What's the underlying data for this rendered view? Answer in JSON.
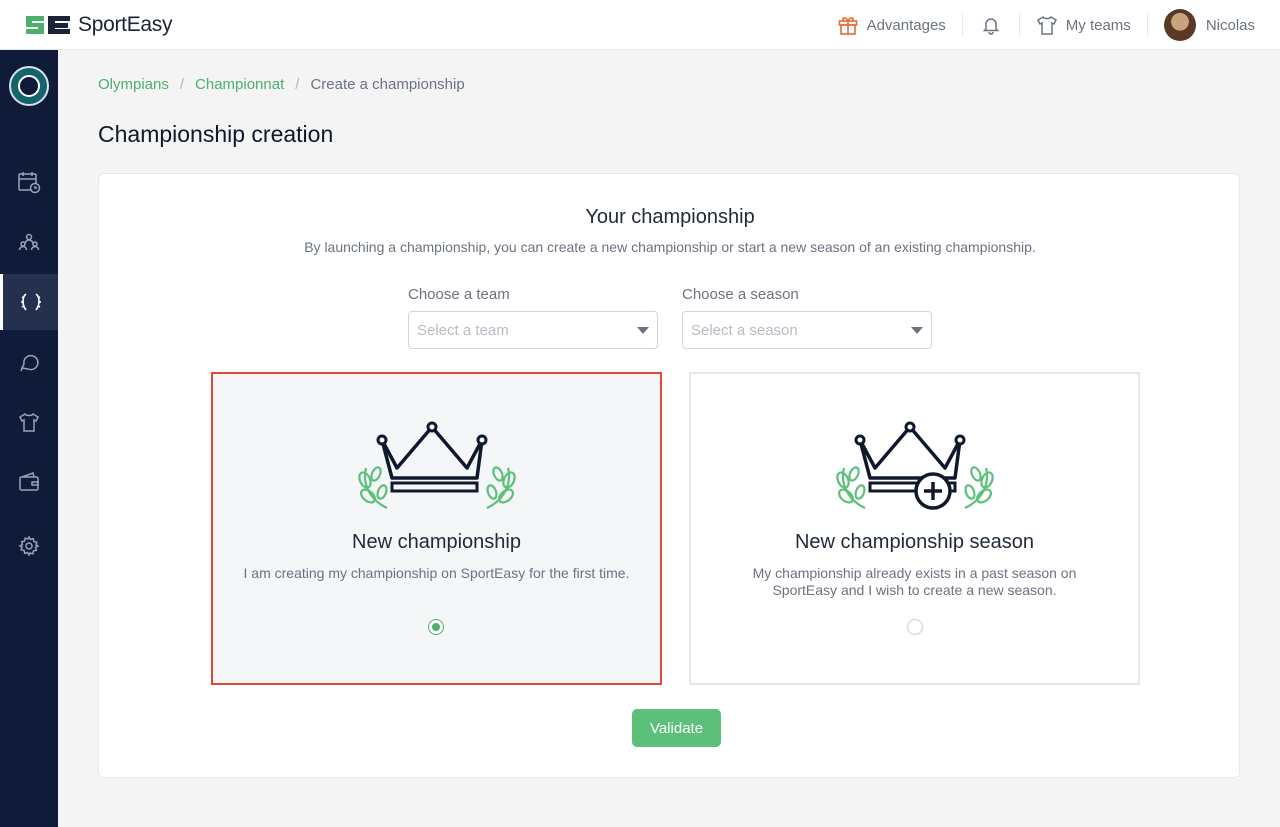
{
  "brand": {
    "name": "SportEasy",
    "accent": "#4caf6c",
    "alert": "#e0493a",
    "sidebar_bg": "#0f1b38"
  },
  "topbar": {
    "advantages_label": "Advantages",
    "my_teams_label": "My teams",
    "user_name": "Nicolas",
    "icons": [
      "gift-icon",
      "bell-icon",
      "shirt-icon",
      "avatar"
    ]
  },
  "sidebar": {
    "items": [
      {
        "name": "calendar-icon"
      },
      {
        "name": "team-members-icon"
      },
      {
        "name": "laurel-icon",
        "active": true
      },
      {
        "name": "chat-icon"
      },
      {
        "name": "shirt-icon"
      },
      {
        "name": "wallet-icon"
      },
      {
        "name": "gear-icon"
      }
    ]
  },
  "breadcrumb": {
    "items": [
      "Olympians",
      "Championnat",
      "Create a championship"
    ]
  },
  "page": {
    "title": "Championship creation"
  },
  "panel": {
    "title": "Your championship",
    "subtitle": "By launching a championship, you can create a new championship or start a new season of an existing championship.",
    "team": {
      "label": "Choose a team",
      "placeholder": "Select a team"
    },
    "season": {
      "label": "Choose a season",
      "placeholder": "Select a season"
    },
    "options": [
      {
        "title": "New championship",
        "description": "I am creating my championship on SportEasy for the first time.",
        "selected": true
      },
      {
        "title": "New championship season",
        "description": "My championship already exists in a past season on SportEasy and I wish to create a new season.",
        "selected": false
      }
    ],
    "validate_label": "Validate"
  }
}
